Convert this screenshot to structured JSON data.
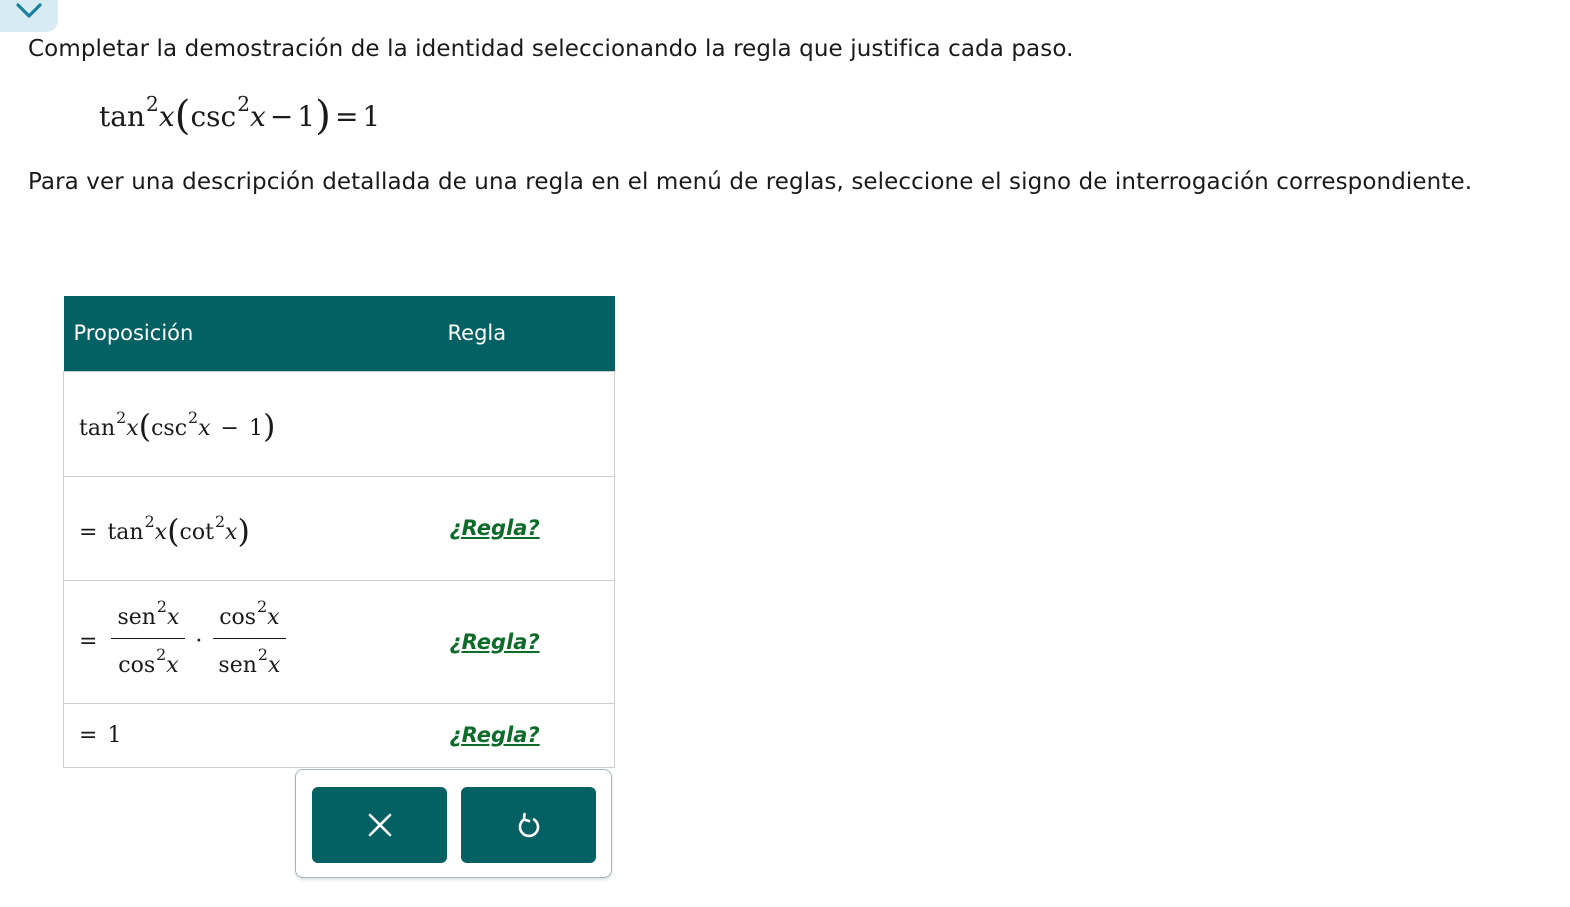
{
  "collapse": {
    "icon": "chevron-down-icon",
    "color": "#1a7fa0"
  },
  "instructions": {
    "line1": "Completar la demostración de la identidad seleccionando la regla que justifica cada paso.",
    "line2": "Para ver una descripción detallada de una regla en el menú de reglas, seleccione el signo de interrogación correspondiente."
  },
  "identity": {
    "tan": "tan",
    "exp": "2",
    "var": "x",
    "csc": "csc",
    "one": "1",
    "rhs": "1"
  },
  "table": {
    "headers": {
      "proposition": "Proposición",
      "rule": "Regla"
    },
    "rows": [
      {
        "expr": {
          "tan": "tan",
          "csc": "csc",
          "exp": "2",
          "var": "x",
          "one": "1"
        },
        "rule": ""
      },
      {
        "expr": {
          "tan": "tan",
          "cot": "cot",
          "exp": "2",
          "var": "x"
        },
        "rule": "¿Regla?"
      },
      {
        "expr": {
          "sen": "sen",
          "cos": "cos",
          "exp": "2",
          "var": "x"
        },
        "rule": "¿Regla?"
      },
      {
        "expr": {
          "one": "1"
        },
        "rule": "¿Regla?"
      }
    ]
  },
  "buttons": {
    "clear": {
      "icon": "close-icon"
    },
    "undo": {
      "icon": "undo-icon"
    }
  },
  "colors": {
    "header_bg": "#036163",
    "button_bg": "#036163",
    "link": "#0e6b2a"
  }
}
